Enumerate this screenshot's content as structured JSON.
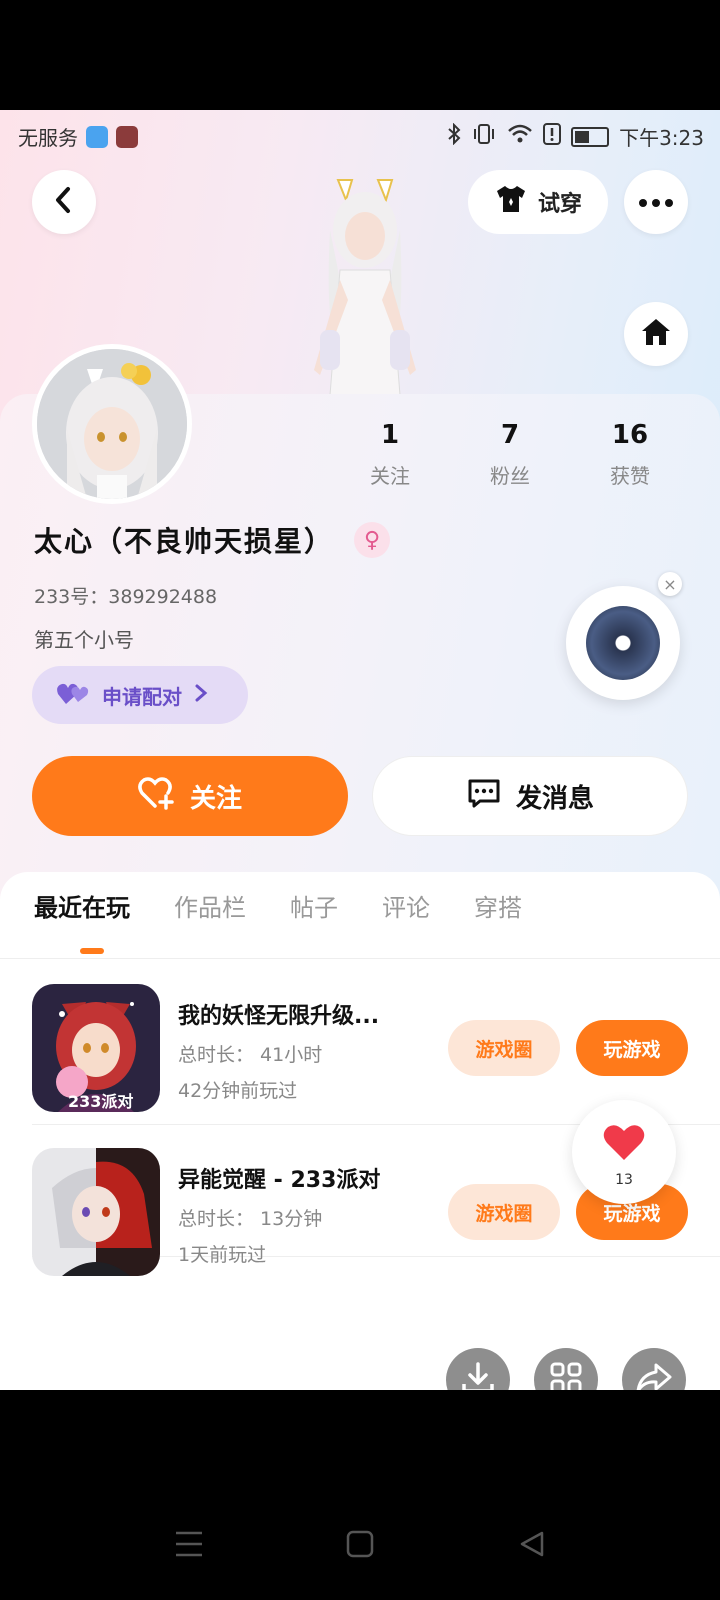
{
  "status_bar": {
    "carrier": "无服务",
    "time": "下午3:23"
  },
  "header": {
    "try_on_label": "试穿"
  },
  "profile": {
    "name": "太心（不良帅天损星）",
    "uid_label": "233号：",
    "uid": "389292488",
    "bio": "第五个小号",
    "pair_label": "申请配对",
    "stats": [
      {
        "value": "1",
        "label": "关注"
      },
      {
        "value": "7",
        "label": "粉丝"
      },
      {
        "value": "16",
        "label": "获赞"
      }
    ]
  },
  "actions": {
    "follow_label": "关注",
    "message_label": "发消息"
  },
  "tabs": [
    {
      "label": "最近在玩",
      "active": true
    },
    {
      "label": "作品栏",
      "active": false
    },
    {
      "label": "帖子",
      "active": false
    },
    {
      "label": "评论",
      "active": false
    },
    {
      "label": "穿搭",
      "active": false
    }
  ],
  "games": [
    {
      "title": "我的妖怪无限升级...",
      "duration": "总时长： 41小时",
      "last_played": "42分钟前玩过",
      "circle_label": "游戏圈",
      "play_label": "玩游戏",
      "icon_text": "233派对"
    },
    {
      "title": "异能觉醒 - 233派对",
      "duration": "总时长： 13分钟",
      "last_played": "1天前玩过",
      "circle_label": "游戏圈",
      "play_label": "玩游戏"
    }
  ],
  "like_count": "13",
  "colors": {
    "accent": "#ff7a1a",
    "pair_purple": "#6a4fc8",
    "heart_red": "#f03a4a"
  }
}
